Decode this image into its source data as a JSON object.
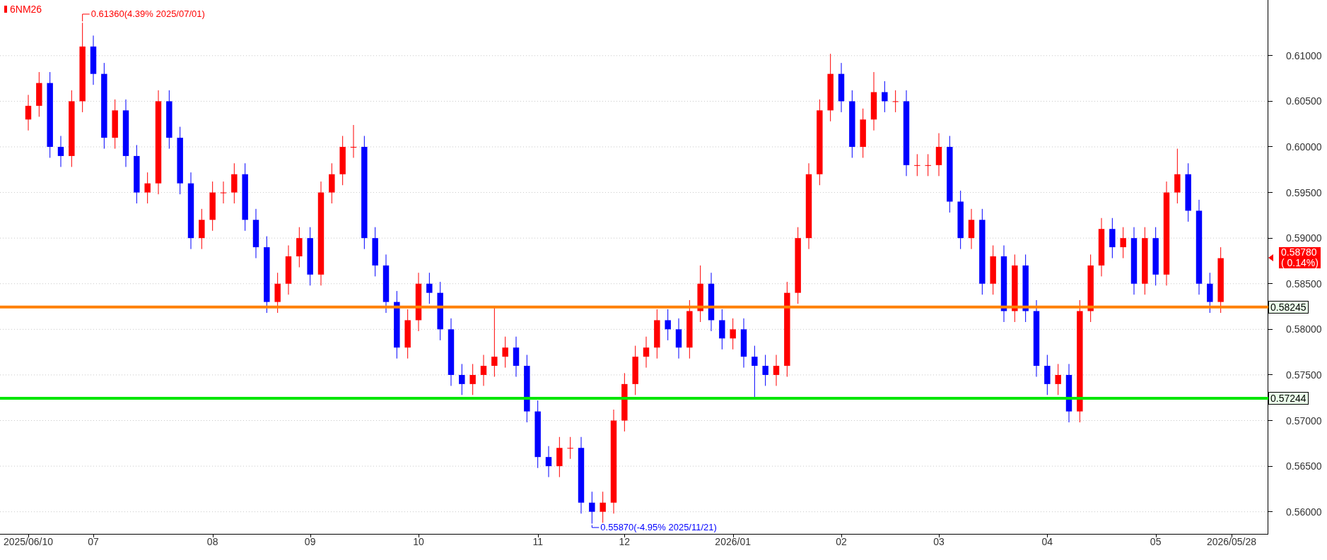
{
  "chart": {
    "chart_data": {
      "type": "candlestick",
      "title": "6NM26",
      "ylim": [
        0.5575,
        0.6161
      ],
      "grid": true,
      "categories": [
        "2025/06/10",
        null,
        null,
        null,
        null,
        null,
        "07",
        null,
        null,
        null,
        null,
        null,
        null,
        null,
        null,
        null,
        null,
        "08",
        null,
        null,
        null,
        null,
        null,
        null,
        null,
        null,
        "09",
        null,
        null,
        null,
        null,
        null,
        null,
        null,
        null,
        null,
        "10",
        null,
        null,
        null,
        null,
        null,
        null,
        null,
        null,
        null,
        null,
        "11",
        null,
        null,
        null,
        null,
        null,
        null,
        null,
        "12",
        null,
        null,
        null,
        null,
        null,
        null,
        null,
        null,
        null,
        "2026/01",
        null,
        null,
        null,
        null,
        null,
        null,
        null,
        null,
        null,
        "02",
        null,
        null,
        null,
        null,
        null,
        null,
        null,
        null,
        "03",
        null,
        null,
        null,
        null,
        null,
        null,
        null,
        null,
        null,
        "04",
        null,
        null,
        null,
        null,
        null,
        null,
        null,
        null,
        null,
        "05",
        null,
        null,
        null,
        null,
        null,
        null,
        "2026/05/28"
      ],
      "yticks": [
        {
          "value": 0.56,
          "label": "0.56000"
        },
        {
          "value": 0.565,
          "label": "0.56500"
        },
        {
          "value": 0.57,
          "label": "0.57000"
        },
        {
          "value": 0.575,
          "label": "0.57500"
        },
        {
          "value": 0.58,
          "label": "0.58000"
        },
        {
          "value": 0.585,
          "label": "0.58500"
        },
        {
          "value": 0.59,
          "label": "0.59000"
        },
        {
          "value": 0.595,
          "label": "0.59500"
        },
        {
          "value": 0.6,
          "label": "0.60000"
        },
        {
          "value": 0.605,
          "label": "0.60500"
        },
        {
          "value": 0.61,
          "label": "0.61000"
        }
      ],
      "ohlc": [
        [
          0.603,
          0.6057,
          0.6018,
          0.6045
        ],
        [
          0.6045,
          0.6082,
          0.6033,
          0.607
        ],
        [
          0.607,
          0.6082,
          0.5988,
          0.6
        ],
        [
          0.6,
          0.6012,
          0.5978,
          0.599
        ],
        [
          0.599,
          0.6062,
          0.5978,
          0.605
        ],
        [
          0.605,
          0.6136,
          0.6038,
          0.611
        ],
        [
          0.611,
          0.6122,
          0.6068,
          0.608
        ],
        [
          0.608,
          0.6092,
          0.5998,
          0.601
        ],
        [
          0.601,
          0.6052,
          0.5998,
          0.604
        ],
        [
          0.604,
          0.6052,
          0.5978,
          0.599
        ],
        [
          0.599,
          0.6002,
          0.5938,
          0.595
        ],
        [
          0.595,
          0.5972,
          0.5938,
          0.596
        ],
        [
          0.596,
          0.6062,
          0.5948,
          0.605
        ],
        [
          0.605,
          0.6062,
          0.5998,
          0.601
        ],
        [
          0.601,
          0.6022,
          0.5948,
          0.596
        ],
        [
          0.596,
          0.5972,
          0.5888,
          0.59
        ],
        [
          0.59,
          0.5932,
          0.5888,
          0.592
        ],
        [
          0.592,
          0.5962,
          0.5908,
          0.595
        ],
        [
          0.595,
          0.5962,
          0.5938,
          0.595
        ],
        [
          0.595,
          0.5982,
          0.5938,
          0.597
        ],
        [
          0.597,
          0.5982,
          0.5908,
          0.592
        ],
        [
          0.592,
          0.5932,
          0.5878,
          0.589
        ],
        [
          0.589,
          0.5902,
          0.5818,
          0.583
        ],
        [
          0.583,
          0.5862,
          0.5818,
          0.585
        ],
        [
          0.585,
          0.5892,
          0.5838,
          0.588
        ],
        [
          0.588,
          0.5912,
          0.5868,
          0.59
        ],
        [
          0.59,
          0.5912,
          0.5848,
          0.586
        ],
        [
          0.586,
          0.5962,
          0.5848,
          0.595
        ],
        [
          0.595,
          0.5982,
          0.5938,
          0.597
        ],
        [
          0.597,
          0.6012,
          0.5958,
          0.6
        ],
        [
          0.6,
          0.6024,
          0.5988,
          0.6
        ],
        [
          0.6,
          0.6012,
          0.5888,
          0.59
        ],
        [
          0.59,
          0.5912,
          0.5858,
          0.587
        ],
        [
          0.587,
          0.5882,
          0.5818,
          0.583
        ],
        [
          0.583,
          0.5842,
          0.5768,
          0.578
        ],
        [
          0.578,
          0.5822,
          0.5768,
          0.581
        ],
        [
          0.581,
          0.5862,
          0.5798,
          0.585
        ],
        [
          0.585,
          0.5862,
          0.5828,
          0.584
        ],
        [
          0.584,
          0.5852,
          0.5788,
          0.58
        ],
        [
          0.58,
          0.5812,
          0.5738,
          0.575
        ],
        [
          0.575,
          0.5762,
          0.5728,
          0.574
        ],
        [
          0.574,
          0.5762,
          0.5728,
          0.575
        ],
        [
          0.575,
          0.5772,
          0.5738,
          0.576
        ],
        [
          0.576,
          0.5825,
          0.5748,
          0.577
        ],
        [
          0.577,
          0.5792,
          0.5758,
          0.578
        ],
        [
          0.578,
          0.5792,
          0.5748,
          0.576
        ],
        [
          0.576,
          0.5772,
          0.5698,
          0.571
        ],
        [
          0.571,
          0.5722,
          0.5648,
          0.566
        ],
        [
          0.566,
          0.5672,
          0.5638,
          0.565
        ],
        [
          0.565,
          0.5682,
          0.5638,
          0.567
        ],
        [
          0.567,
          0.5682,
          0.5658,
          0.567
        ],
        [
          0.567,
          0.5682,
          0.5598,
          0.561
        ],
        [
          0.561,
          0.5622,
          0.5587,
          0.56
        ],
        [
          0.56,
          0.5622,
          0.5588,
          0.561
        ],
        [
          0.561,
          0.5712,
          0.5598,
          0.57
        ],
        [
          0.57,
          0.5752,
          0.5688,
          0.574
        ],
        [
          0.574,
          0.5782,
          0.5728,
          0.577
        ],
        [
          0.577,
          0.5792,
          0.5758,
          0.578
        ],
        [
          0.578,
          0.5822,
          0.5768,
          0.581
        ],
        [
          0.581,
          0.5822,
          0.5788,
          0.58
        ],
        [
          0.58,
          0.5812,
          0.5768,
          0.578
        ],
        [
          0.578,
          0.5832,
          0.5768,
          0.582
        ],
        [
          0.582,
          0.587,
          0.5808,
          0.585
        ],
        [
          0.585,
          0.5862,
          0.5798,
          0.581
        ],
        [
          0.581,
          0.5822,
          0.5778,
          0.579
        ],
        [
          0.579,
          0.5812,
          0.5778,
          0.58
        ],
        [
          0.58,
          0.5812,
          0.5758,
          0.577
        ],
        [
          0.577,
          0.5782,
          0.5724,
          0.576
        ],
        [
          0.576,
          0.5772,
          0.5738,
          0.575
        ],
        [
          0.575,
          0.5772,
          0.5738,
          0.576
        ],
        [
          0.576,
          0.5852,
          0.5748,
          0.584
        ],
        [
          0.584,
          0.5912,
          0.5828,
          0.59
        ],
        [
          0.59,
          0.5982,
          0.5888,
          0.597
        ],
        [
          0.597,
          0.6052,
          0.5958,
          0.604
        ],
        [
          0.604,
          0.6102,
          0.6028,
          0.608
        ],
        [
          0.608,
          0.6092,
          0.6038,
          0.605
        ],
        [
          0.605,
          0.6062,
          0.5988,
          0.6
        ],
        [
          0.6,
          0.6042,
          0.5988,
          0.603
        ],
        [
          0.603,
          0.6082,
          0.6018,
          0.606
        ],
        [
          0.606,
          0.6072,
          0.6038,
          0.605
        ],
        [
          0.605,
          0.6062,
          0.6038,
          0.605
        ],
        [
          0.605,
          0.6062,
          0.5968,
          0.598
        ],
        [
          0.598,
          0.5992,
          0.5968,
          0.598
        ],
        [
          0.598,
          0.5992,
          0.5968,
          0.598
        ],
        [
          0.598,
          0.6015,
          0.5968,
          0.6
        ],
        [
          0.6,
          0.6012,
          0.5928,
          0.594
        ],
        [
          0.594,
          0.5952,
          0.5888,
          0.59
        ],
        [
          0.59,
          0.5932,
          0.5888,
          0.592
        ],
        [
          0.592,
          0.5932,
          0.5838,
          0.585
        ],
        [
          0.585,
          0.5892,
          0.5838,
          0.588
        ],
        [
          0.588,
          0.5892,
          0.5808,
          0.582
        ],
        [
          0.582,
          0.5882,
          0.5808,
          0.587
        ],
        [
          0.587,
          0.5882,
          0.5808,
          0.582
        ],
        [
          0.582,
          0.5832,
          0.5748,
          0.576
        ],
        [
          0.576,
          0.5772,
          0.5728,
          0.574
        ],
        [
          0.574,
          0.5762,
          0.5728,
          0.575
        ],
        [
          0.575,
          0.5762,
          0.5698,
          0.571
        ],
        [
          0.571,
          0.5832,
          0.5698,
          0.582
        ],
        [
          0.582,
          0.5882,
          0.5808,
          0.587
        ],
        [
          0.587,
          0.5922,
          0.5858,
          0.591
        ],
        [
          0.591,
          0.5922,
          0.5878,
          0.589
        ],
        [
          0.589,
          0.5912,
          0.5878,
          0.59
        ],
        [
          0.59,
          0.5912,
          0.5838,
          0.585
        ],
        [
          0.585,
          0.5912,
          0.5838,
          0.59
        ],
        [
          0.59,
          0.5912,
          0.5848,
          0.586
        ],
        [
          0.586,
          0.5962,
          0.5848,
          0.595
        ],
        [
          0.595,
          0.5998,
          0.5938,
          0.597
        ],
        [
          0.597,
          0.5982,
          0.5918,
          0.593
        ],
        [
          0.593,
          0.5942,
          0.5838,
          0.585
        ],
        [
          0.585,
          0.5862,
          0.5818,
          0.583
        ],
        [
          0.583,
          0.589,
          0.5818,
          0.5878
        ],
        null
      ],
      "ref_lines": [
        {
          "axis": "y",
          "value": 0.58245,
          "label": "0.58245",
          "color": "#ff8000"
        },
        {
          "axis": "y",
          "value": 0.57244,
          "label": "0.57244",
          "color": "#00e600"
        }
      ],
      "annotations": [
        "0.61360(4.39% 2025/07/01)",
        "0.55870(-4.95% 2025/11/21)",
        "0.58780\n( 0.14%)"
      ]
    }
  }
}
